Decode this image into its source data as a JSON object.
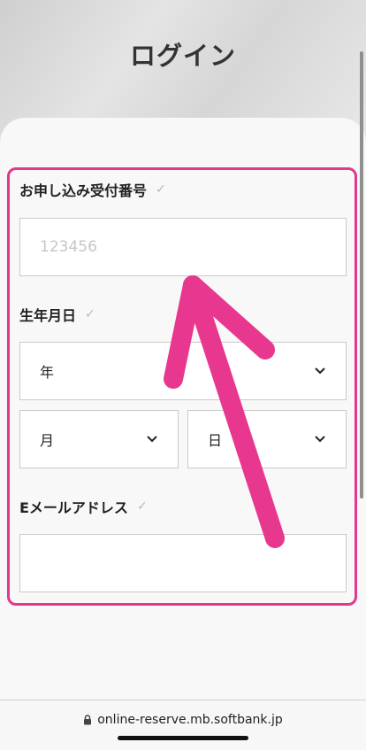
{
  "page": {
    "title": "ログイン"
  },
  "form": {
    "reception_number": {
      "label": "お申し込み受付番号",
      "check_icon": "check-icon",
      "placeholder": "123456",
      "value": ""
    },
    "birthdate": {
      "label": "生年月日",
      "check_icon": "check-icon",
      "year_label": "年",
      "month_label": "月",
      "day_label": "日"
    },
    "email": {
      "label": "Eメールアドレス",
      "check_icon": "check-icon",
      "value": ""
    }
  },
  "browser": {
    "url": "online-reserve.mb.softbank.jp",
    "lock_icon": "lock-icon"
  },
  "colors": {
    "highlight": "#e0398d",
    "arrow": "#e8378f"
  }
}
